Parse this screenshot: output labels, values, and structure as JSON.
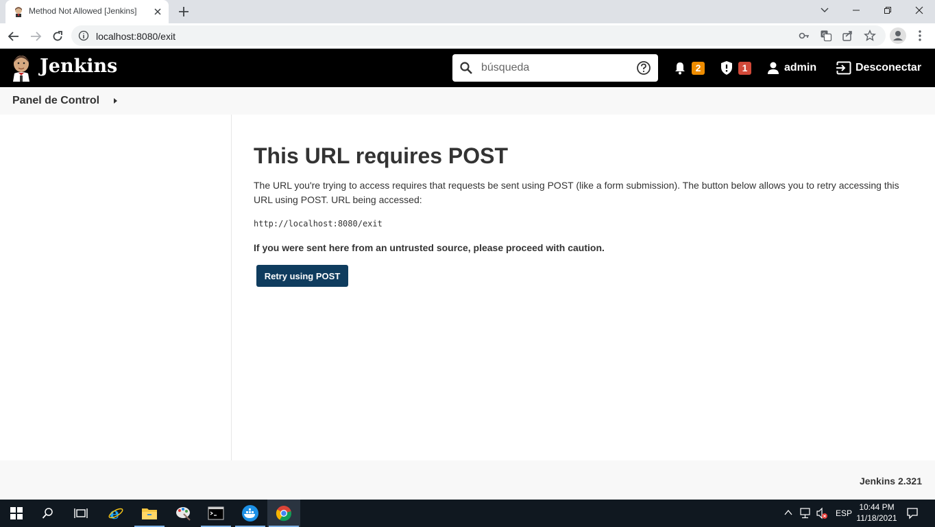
{
  "browser": {
    "tab_title": "Method Not Allowed [Jenkins]",
    "url": "localhost:8080/exit"
  },
  "header": {
    "brand": "Jenkins",
    "search_placeholder": "búsqueda",
    "notifications_count": "2",
    "security_count": "1",
    "user": "admin",
    "logout": "Desconectar",
    "notification_badge_color": "#ee8c00",
    "security_badge_color": "#d24939"
  },
  "breadcrumb": {
    "item": "Panel de Control"
  },
  "main": {
    "title": "This URL requires POST",
    "description": "The URL you're trying to access requires that requests be sent using POST (like a form submission). The button below allows you to retry accessing this URL using POST. URL being accessed:",
    "url": "http://localhost:8080/exit",
    "warning": "If you were sent here from an untrusted source, please proceed with caution.",
    "retry_button": "Retry using POST"
  },
  "footer": {
    "version": "Jenkins 2.321"
  },
  "taskbar": {
    "language": "ESP",
    "time": "10:44 PM",
    "date": "11/18/2021",
    "apps": [
      "windows-start",
      "search",
      "task-view",
      "internet-explorer",
      "file-explorer",
      "paint",
      "terminal",
      "docker",
      "chrome"
    ]
  }
}
